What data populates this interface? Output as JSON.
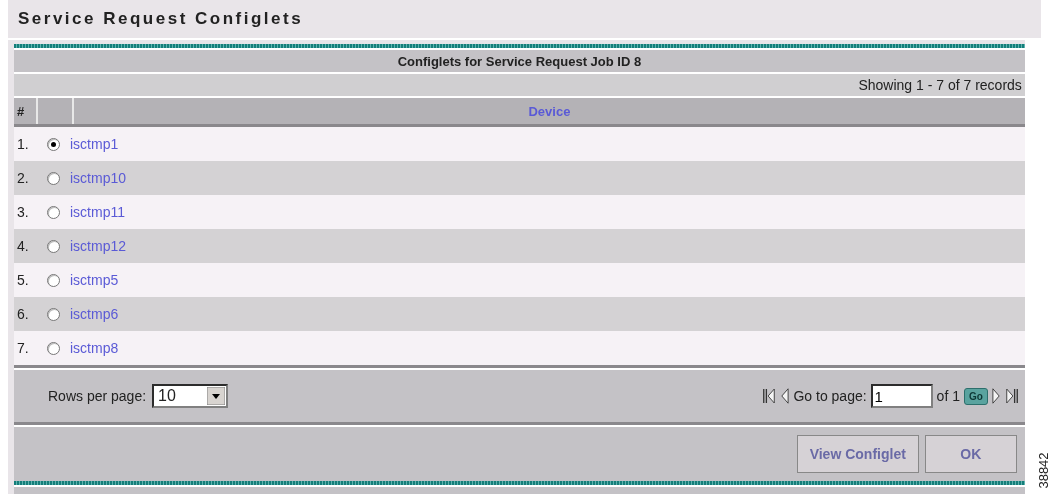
{
  "page_title": "Service Request Configlets",
  "table": {
    "title": "Configlets for Service Request Job ID 8",
    "record_count": "Showing 1 - 7 of 7 records",
    "columns": [
      "#",
      "Device"
    ],
    "rows": [
      {
        "index": "1.",
        "device": "isctmp1",
        "selected": true
      },
      {
        "index": "2.",
        "device": "isctmp10",
        "selected": false
      },
      {
        "index": "3.",
        "device": "isctmp11",
        "selected": false
      },
      {
        "index": "4.",
        "device": "isctmp12",
        "selected": false
      },
      {
        "index": "5.",
        "device": "isctmp5",
        "selected": false
      },
      {
        "index": "6.",
        "device": "isctmp6",
        "selected": false
      },
      {
        "index": "7.",
        "device": "isctmp8",
        "selected": false
      }
    ]
  },
  "pagination": {
    "rows_per_page_label": "Rows per page:",
    "rows_per_page": "10",
    "goto_label": "Go to page:",
    "page": "1",
    "of_label": "of 1",
    "go_button": "Go"
  },
  "buttons": [
    "View Configlet",
    "OK"
  ],
  "figure_number": "38842"
}
